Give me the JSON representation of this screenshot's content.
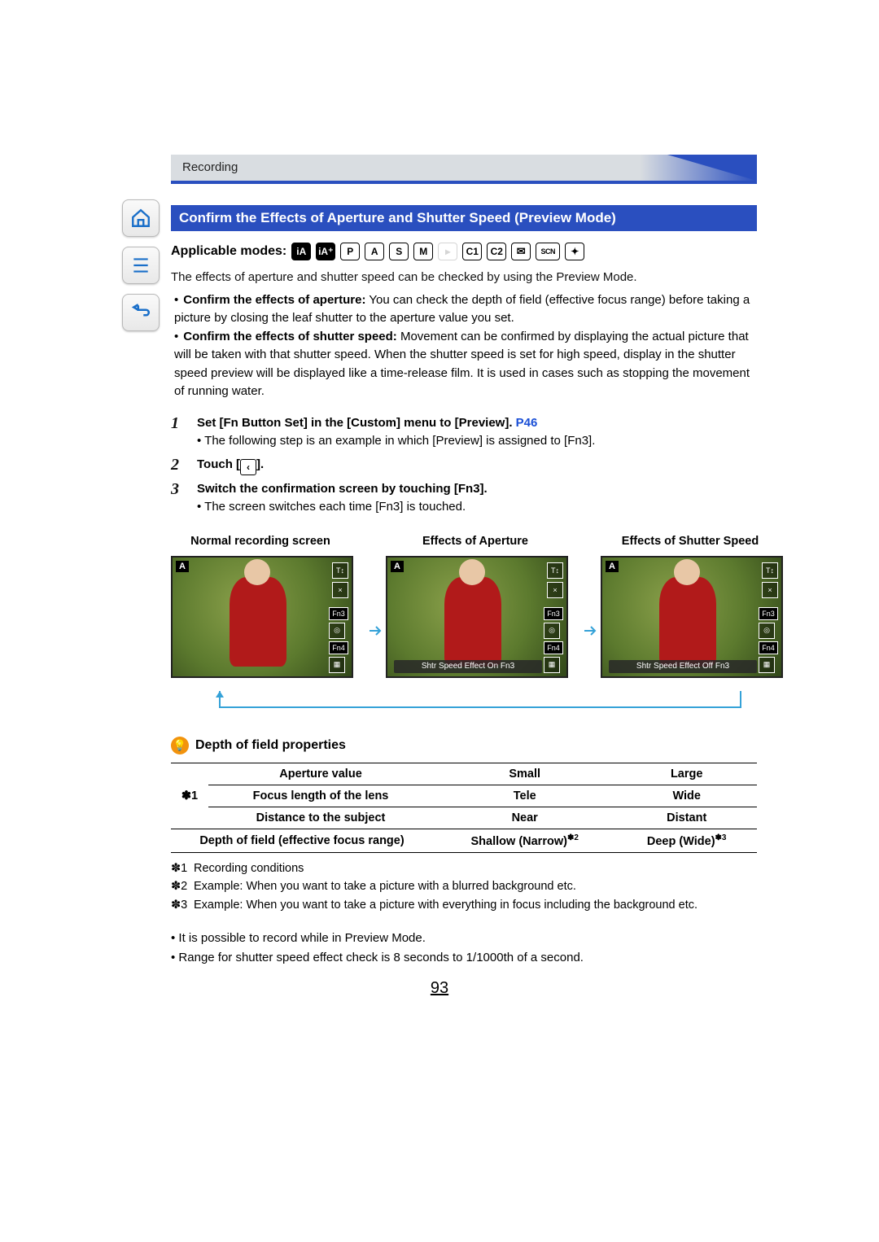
{
  "breadcrumb": "Recording",
  "section_title": "Confirm the Effects of Aperture and Shutter Speed (Preview Mode)",
  "applicable_label": "Applicable modes:",
  "modes": [
    "iA",
    "iA+",
    "P",
    "A",
    "S",
    "M",
    "mov",
    "C1",
    "C2",
    "env",
    "SCN",
    "art"
  ],
  "intro": "The effects of aperture and shutter speed can be checked by using the Preview Mode.",
  "bullet_aperture_lead": "Confirm the effects of aperture:",
  "bullet_aperture_rest": " You can check the depth of field (effective focus range) before taking a picture by closing the leaf shutter to the aperture value you set.",
  "bullet_shutter_lead": "Confirm the effects of shutter speed:",
  "bullet_shutter_rest": " Movement can be confirmed by displaying the actual picture that will be taken with that shutter speed. When the shutter speed is set for high speed, display in the shutter speed preview will be displayed like a time-release film. It is used in cases such as stopping the movement of running water.",
  "steps": [
    {
      "num": "1",
      "title_a": "Set [Fn Button Set] in the [Custom] menu to [Preview]. ",
      "page_ref": "P46",
      "sub": "The following step is an example in which [Preview] is assigned to [Fn3]."
    },
    {
      "num": "2",
      "title_a": "Touch [",
      "title_b": "].",
      "sub": ""
    },
    {
      "num": "3",
      "title_a": "Switch the confirmation screen by touching [Fn3].",
      "sub": "The screen switches each time [Fn3] is touched."
    }
  ],
  "screen_labels": [
    "Normal recording screen",
    "Effects of Aperture",
    "Effects of Shutter Speed"
  ],
  "screen_corner": "A",
  "overlay_on": "Shtr Speed Effect On   Fn3",
  "overlay_off": "Shtr Speed Effect Off   Fn3",
  "fn_labels": [
    "Fn3",
    "Fn4"
  ],
  "dof_title": "Depth of field properties",
  "dof_table": {
    "rowhdr": "✽1",
    "rows": [
      [
        "Aperture value",
        "Small",
        "Large"
      ],
      [
        "Focus length of the lens",
        "Tele",
        "Wide"
      ],
      [
        "Distance to the subject",
        "Near",
        "Distant"
      ],
      [
        "Depth of field (effective focus range)",
        "Shallow (Narrow)",
        "Deep (Wide)"
      ]
    ],
    "sup_narrow": "✽2",
    "sup_wide": "✽3"
  },
  "footnotes": [
    {
      "mark": "✽1",
      "text": "Recording conditions"
    },
    {
      "mark": "✽2",
      "text": "Example: When you want to take a picture with a blurred background etc."
    },
    {
      "mark": "✽3",
      "text": "Example: When you want to take a picture with everything in focus including the background etc."
    }
  ],
  "end_bullets": [
    "It is possible to record while in Preview Mode.",
    "Range for shutter speed effect check is 8 seconds to 1/1000th of a second."
  ],
  "page_number": "93"
}
